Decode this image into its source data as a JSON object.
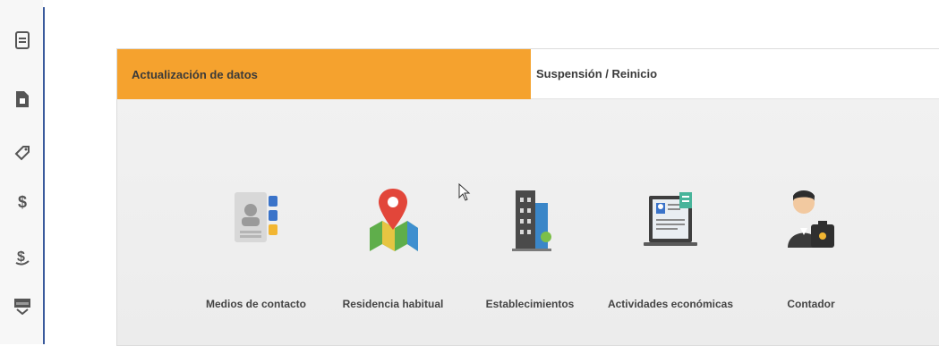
{
  "sidebar": {
    "icons": [
      "document-icon",
      "file-icon",
      "tag-icon",
      "dollar-icon",
      "dollar-return-icon",
      "money-icon"
    ]
  },
  "tabs": [
    {
      "label": "Actualización de datos",
      "active": true
    },
    {
      "label": "Suspensión / Reinicio",
      "active": false
    }
  ],
  "options": [
    {
      "label": "Medios de contacto",
      "icon": "contact-card-icon"
    },
    {
      "label": "Residencia habitual",
      "icon": "map-pin-icon"
    },
    {
      "label": "Establecimientos",
      "icon": "building-icon"
    },
    {
      "label": "Actividades económicas",
      "icon": "laptop-certificate-icon"
    },
    {
      "label": "Contador",
      "icon": "accountant-icon"
    }
  ],
  "colors": {
    "accent": "#f5a22e",
    "sidebar_line": "#3a5a9c"
  }
}
